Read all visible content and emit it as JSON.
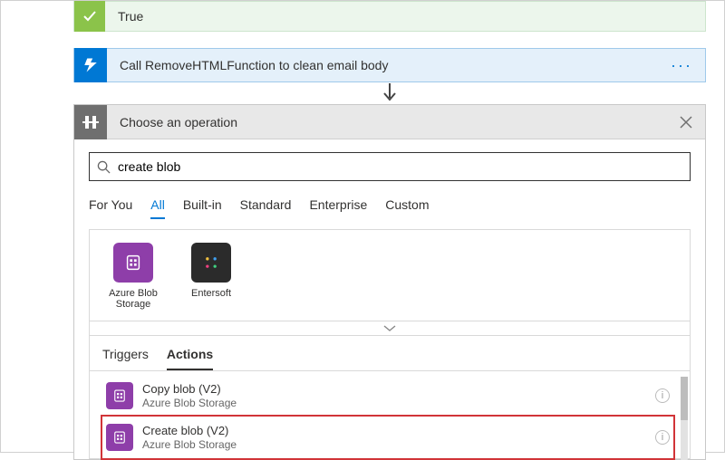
{
  "condition": {
    "title": "True"
  },
  "action_card": {
    "title": "Call RemoveHTMLFunction to clean email body"
  },
  "choose": {
    "title": "Choose an operation",
    "search_value": "create blob",
    "filter_tabs": [
      {
        "label": "For You",
        "active": false
      },
      {
        "label": "All",
        "active": true
      },
      {
        "label": "Built-in",
        "active": false
      },
      {
        "label": "Standard",
        "active": false
      },
      {
        "label": "Enterprise",
        "active": false
      },
      {
        "label": "Custom",
        "active": false
      }
    ],
    "connectors": [
      {
        "name": "Azure Blob Storage",
        "tile": "purple"
      },
      {
        "name": "Entersoft",
        "tile": "dark"
      }
    ],
    "sub_tabs": [
      {
        "label": "Triggers",
        "active": false
      },
      {
        "label": "Actions",
        "active": true
      }
    ],
    "actions": [
      {
        "title": "Copy blob (V2)",
        "subtitle": "Azure Blob Storage",
        "highlight": false
      },
      {
        "title": "Create blob (V2)",
        "subtitle": "Azure Blob Storage",
        "highlight": true
      }
    ]
  }
}
